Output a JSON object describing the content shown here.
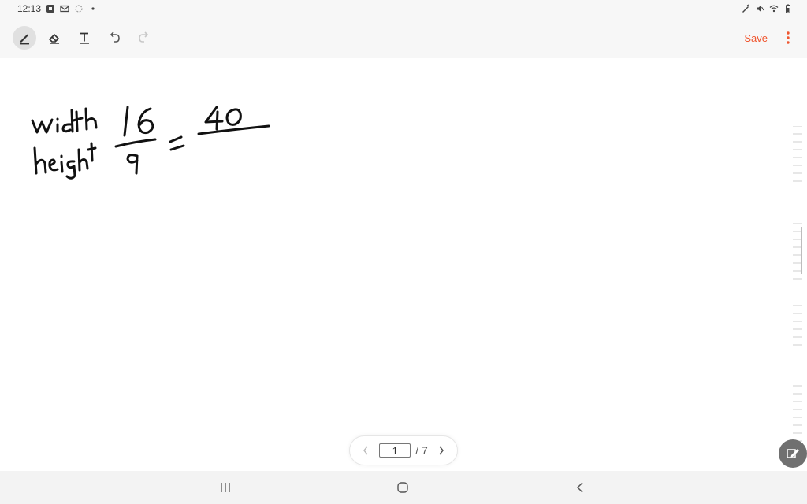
{
  "status_bar": {
    "time": "12:13",
    "left_icons": [
      "notification-icon",
      "mail-icon",
      "app-icon",
      "dot-icon"
    ],
    "right_icons": [
      "pen-icon",
      "mute-icon",
      "wifi-icon",
      "battery-icon"
    ]
  },
  "toolbar": {
    "tools": [
      "pen-icon",
      "eraser-icon",
      "text-icon",
      "undo-icon",
      "redo-icon"
    ],
    "active_tool": "pen",
    "save_label": "Save",
    "accent_color": "#f0562f"
  },
  "canvas": {
    "handwriting": [
      "width",
      "height",
      "16",
      "9",
      "=",
      "40"
    ]
  },
  "pager": {
    "current_page": "1",
    "total_label": "/ 7"
  },
  "colors": {
    "ink": "#111111",
    "bar_background": "#f7f7f7",
    "nav_background": "#f3f3f3"
  }
}
